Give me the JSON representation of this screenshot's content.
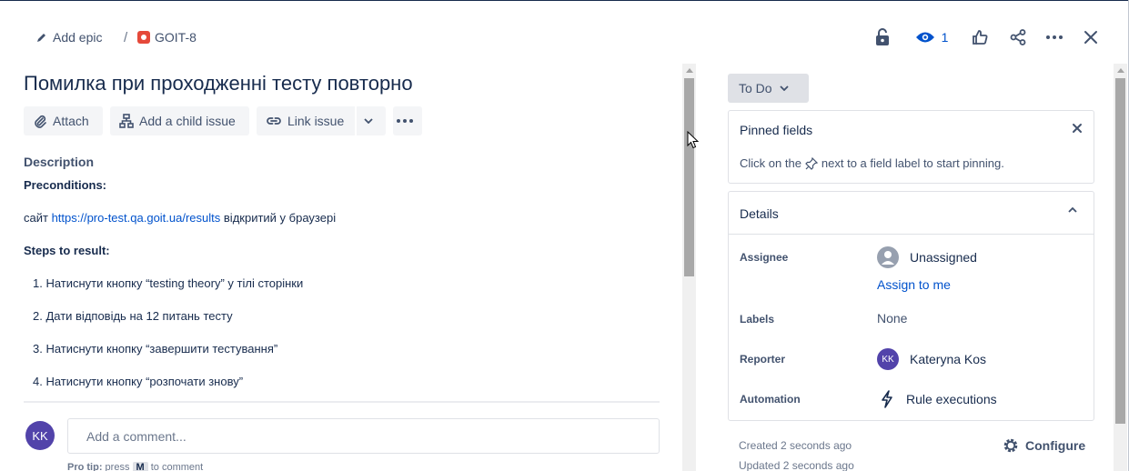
{
  "breadcrumb": {
    "add_epic": "Add epic",
    "separator": "/",
    "issue_key": "GOIT-8"
  },
  "header_actions": {
    "watch_count": "1"
  },
  "issue": {
    "title": "Помилка при проходженні тесту повторно"
  },
  "toolbar": {
    "attach": "Attach",
    "add_child": "Add a child issue",
    "link_issue": "Link issue"
  },
  "description": {
    "label": "Description",
    "preconditions_heading": "Preconditions:",
    "precondition_prefix": "сайт ",
    "precondition_link": "https://pro-test.qa.goit.ua/results",
    "precondition_suffix": " відкритий у браузері",
    "steps_heading": "Steps to result:",
    "steps": [
      "1. Натиснути кнопку “testing theory” у тілі сторінки",
      "2. Дати відповідь на 12 питань тесту",
      "3. Натиснути кнопку “завершити тестування”",
      "4. Натиснути кнопку “розпочати знову”"
    ]
  },
  "comment": {
    "avatar_initials": "KK",
    "placeholder": "Add a comment...",
    "protip_prefix": "Pro tip:",
    "protip_press": " press ",
    "protip_key": "M",
    "protip_suffix": " to comment"
  },
  "status": {
    "label": "To Do"
  },
  "pinned": {
    "title": "Pinned fields",
    "message_before": "Click on the",
    "message_after": "next to a field label to start pinning."
  },
  "details": {
    "title": "Details",
    "fields": {
      "assignee_label": "Assignee",
      "assignee_value": "Unassigned",
      "assign_to_me": "Assign to me",
      "labels_label": "Labels",
      "labels_value": "None",
      "reporter_label": "Reporter",
      "reporter_initials": "KK",
      "reporter_value": "Kateryna Kos",
      "automation_label": "Automation",
      "automation_value": "Rule executions"
    }
  },
  "footer": {
    "created": "Created 2 seconds ago",
    "updated": "Updated 2 seconds ago",
    "configure": "Configure"
  },
  "colors": {
    "link": "#0052cc",
    "avatar": "#5243aa",
    "bug": "#e5493a",
    "text": "#172b4d"
  }
}
